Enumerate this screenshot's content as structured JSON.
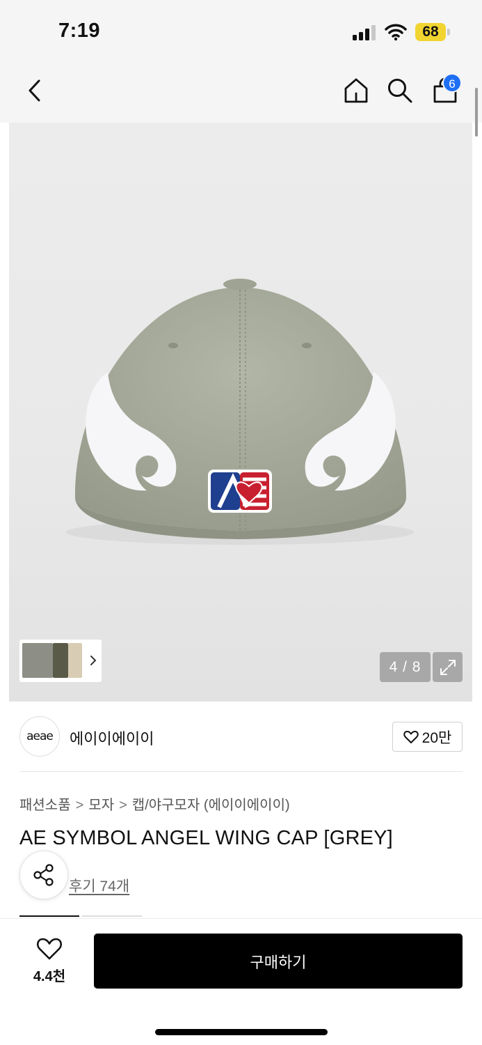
{
  "status_bar": {
    "time": "7:19",
    "battery": "68"
  },
  "nav": {
    "cart_count": "6"
  },
  "gallery": {
    "counter": "4 / 8",
    "thumbnail_colors": [
      "#9a9b8d",
      "#5a5a48",
      "#d8cdb4"
    ]
  },
  "brand": {
    "logo_text": "aeae",
    "name": "에이이에이이",
    "like_count": "20만"
  },
  "breadcrumb": {
    "level1": "패션소품",
    "level2": "모자",
    "level3": "캡/야구모자 (에이이에이이)"
  },
  "product": {
    "title": "AE SYMBOL ANGEL WING CAP [GREY]",
    "reviews_label": "후기 74개"
  },
  "bottom_bar": {
    "wish_count": "4.4천",
    "buy_label": "구매하기"
  },
  "colors": {
    "cap": "#a7ab9b",
    "accent_badge": "#1f6ff5",
    "battery": "#f2d431",
    "button": "#000000"
  }
}
